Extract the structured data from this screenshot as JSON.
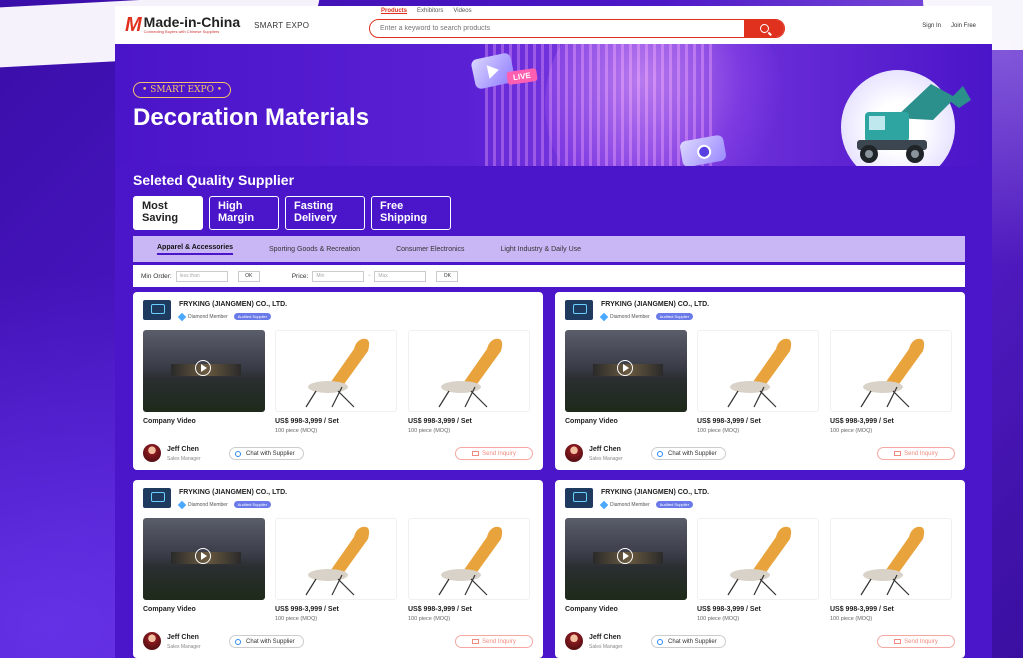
{
  "header": {
    "logo_mark": "M",
    "logo_name": "Made-in-China",
    "logo_tagline": "Connecting Buyers with Chinese Suppliers",
    "smart_expo": "SMART EXPO",
    "search_tabs": [
      "Products",
      "Exhibitors",
      "Videos"
    ],
    "search_placeholder": "Enter a keyword to search products",
    "sign_in": "Sign In",
    "join_free": "Join Free"
  },
  "hero": {
    "badge": "• SMART EXPO •",
    "title": "Decoration Materials",
    "live_tag": "LIVE"
  },
  "section": {
    "title": "Seleted Quality Supplier",
    "tabs": [
      {
        "line1": "Most",
        "line2": "Saving"
      },
      {
        "line1": "High",
        "line2": "Margin"
      },
      {
        "line1": "Fasting",
        "line2": "Delivery"
      },
      {
        "line1": "Free",
        "line2": "Shipping"
      }
    ],
    "categories": [
      "Apparel & Accessories",
      "Sporting Goods & Recreation",
      "Consumer Electronics",
      "Light Industry & Daily Use"
    ]
  },
  "filters": {
    "min_order_label": "Min Order:",
    "min_order_placeholder": "less than",
    "ok1": "OK",
    "price_label": "Price:",
    "price_min_placeholder": "Min",
    "dash": "-",
    "price_max_placeholder": "Max",
    "ok2": "OK"
  },
  "card": {
    "company": "FRYKING (JIANGMEN) CO., LTD.",
    "member": "Diamond Member",
    "verified": "Audited Supplier",
    "video_label": "Company Video",
    "price": "US$ 998-3,999 / Set",
    "moq": "100 piece   (MOQ)",
    "contact": "Jeff Chen",
    "role": "Sales Manager",
    "chat": "Chat with Supplier",
    "inquiry": "Send Inquiry"
  },
  "colors": {
    "accent": "#e0311f",
    "purple": "#4b16c9",
    "category_bar": "#c9b6f5",
    "chair": "#e8a33c"
  }
}
